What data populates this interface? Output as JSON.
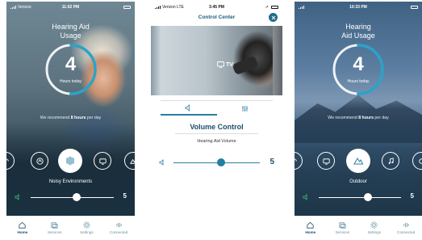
{
  "screens": {
    "home_noisy": {
      "status": {
        "carrier": "Verizon",
        "time": "11:02 PM"
      },
      "title": "Hearing Aid Usage",
      "ring": {
        "value": "4",
        "caption": "Hours today",
        "progress": 0.5
      },
      "recommend": {
        "prefix": "We recommend ",
        "bold": "8 hours",
        "suffix": " per day"
      },
      "environment": "Noisy Environments",
      "volume": {
        "value": "5",
        "level": 0.55
      },
      "tabs": [
        "Home",
        "Services",
        "Settings",
        "Connected"
      ]
    },
    "control_center": {
      "status": {
        "carrier": "Verizon  LTE",
        "time": "3:45 PM"
      },
      "title": "Control Center",
      "tv_label": "TV",
      "section_title": "Volume Control",
      "subtitle": "Hearing Aid Volume",
      "volume": {
        "value": "5",
        "level": 0.55
      }
    },
    "home_outdoor": {
      "status": {
        "time": "10:33 PM"
      },
      "title_line1": "Hearing",
      "title_line2": "Aid Usage",
      "ring": {
        "value": "4",
        "caption": "Hours today",
        "progress": 0.5
      },
      "recommend": {
        "prefix": "We recommend ",
        "bold": "8 hours",
        "suffix": " per day"
      },
      "environment": "Outdoor",
      "volume": {
        "value": "5",
        "level": 0.6
      },
      "tabs": [
        "Home",
        "Services",
        "Settings",
        "Connected"
      ]
    }
  },
  "colors": {
    "accent": "#1f7fa6",
    "ring_progress": "#2aa3c7",
    "tab_active": "#1d4f6b",
    "tab_inactive": "#6a8fa3"
  }
}
